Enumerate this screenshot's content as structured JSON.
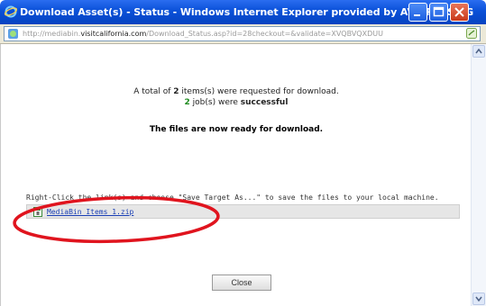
{
  "window": {
    "title": "Download Asset(s) - Status - Windows Internet Explorer provided by AVIAREPS AG",
    "accent_color": "#0a50d8"
  },
  "address_bar": {
    "url_prefix": "http://mediabin.",
    "url_domain": "visitcalifornia.com",
    "url_path": "/Download_Status.asp?id=28checkout=&validate=XVQBVQXDUU"
  },
  "status": {
    "summary_prefix": "A total of ",
    "requested_count": "2",
    "summary_suffix": " items(s) were requested for download.",
    "jobs_count": "2",
    "jobs_text": " job(s) were ",
    "jobs_result": "successful",
    "ready_message": "The files are now ready for download."
  },
  "instructions": "Right-Click the link(s) and choose \"Save Target As...\" to save the files to your local machine.",
  "files": [
    {
      "name": "MediaBin_Items_1.zip",
      "icon": "zip-file-icon"
    }
  ],
  "buttons": {
    "close_label": "Close"
  },
  "annotation": {
    "color": "#e0141e"
  }
}
